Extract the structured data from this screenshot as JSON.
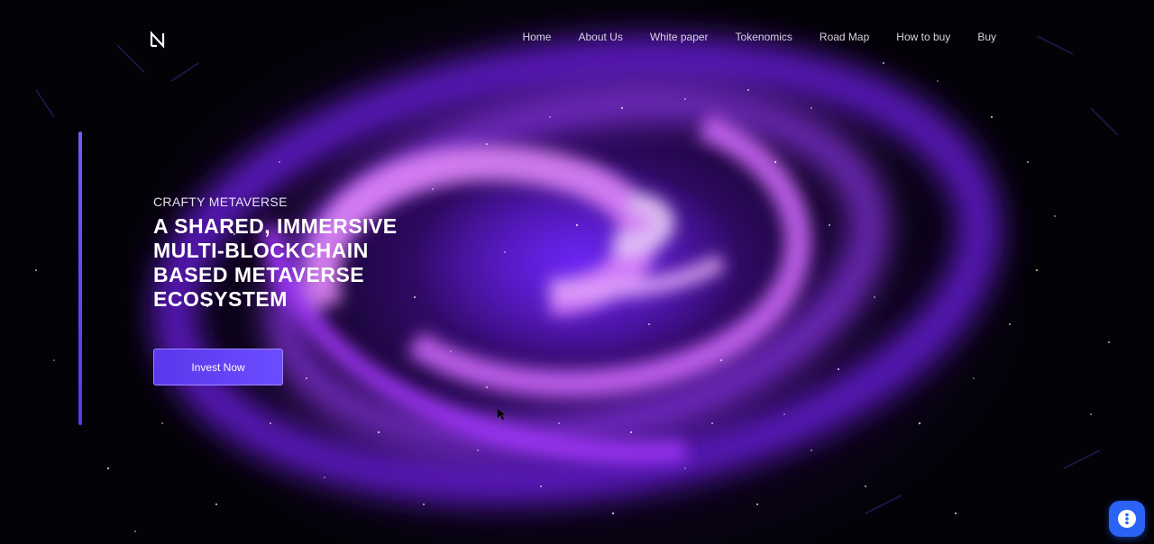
{
  "nav": {
    "items": [
      {
        "label": "Home"
      },
      {
        "label": "About Us"
      },
      {
        "label": "White paper"
      },
      {
        "label": "Tokenomics"
      },
      {
        "label": "Road Map"
      },
      {
        "label": "How to buy"
      },
      {
        "label": "Buy"
      }
    ]
  },
  "hero": {
    "eyebrow": "CRAFTY METAVERSE",
    "headline_lines": [
      "A SHARED, IMMERSIVE",
      "MULTI-BLOCKCHAIN",
      "BASED METAVERSE",
      "ECOSYSTEM"
    ],
    "cta_label": "Invest Now"
  },
  "icons": {
    "logo": "brand-logo-icon",
    "chat": "chat-widget-icon"
  },
  "colors": {
    "accent": "#6b4dff",
    "chat_widget": "#2b63f5",
    "background": "#030207"
  }
}
